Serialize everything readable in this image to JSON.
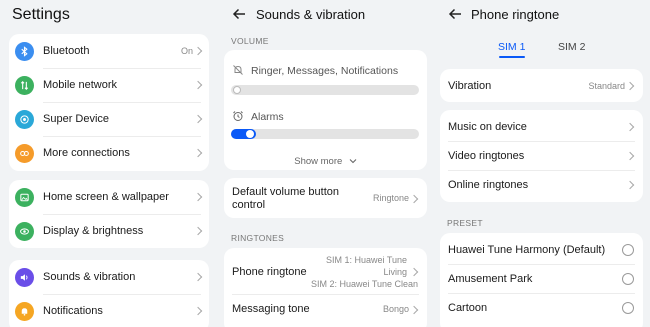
{
  "settings": {
    "title": "Settings",
    "group1": [
      {
        "label": "Bluetooth",
        "value": "On",
        "icon": "bluetooth-icon",
        "color": "#3b8ef0"
      },
      {
        "label": "Mobile network",
        "value": "",
        "icon": "mobile-network-icon",
        "color": "#3cb15f"
      },
      {
        "label": "Super Device",
        "value": "",
        "icon": "super-device-icon",
        "color": "#2aa8d8"
      },
      {
        "label": "More connections",
        "value": "",
        "icon": "more-connections-icon",
        "color": "#f59b2a"
      }
    ],
    "group2": [
      {
        "label": "Home screen & wallpaper",
        "icon": "home-screen-icon",
        "color": "#3cb15f"
      },
      {
        "label": "Display & brightness",
        "icon": "display-icon",
        "color": "#3cb15f"
      }
    ],
    "group3": [
      {
        "label": "Sounds & vibration",
        "icon": "sound-icon",
        "color": "#6a4ee8"
      },
      {
        "label": "Notifications",
        "icon": "notifications-icon",
        "color": "#f5a623"
      }
    ]
  },
  "sounds": {
    "title": "Sounds & vibration",
    "volume_header": "VOLUME",
    "ringer_label": "Ringer, Messages, Notifications",
    "ringer_level": 0,
    "alarms_label": "Alarms",
    "alarms_level": 0.1,
    "show_more": "Show more",
    "default_volume_label": "Default volume button control",
    "default_volume_value": "Ringtone",
    "ringtones_header": "RINGTONES",
    "phone_ringtone_label": "Phone ringtone",
    "phone_ringtone_sim1": "SIM 1: Huawei Tune Living",
    "phone_ringtone_sim2": "SIM 2: Huawei Tune Clean",
    "messaging_tone_label": "Messaging tone",
    "messaging_tone_value": "Bongo"
  },
  "phone_ringtone": {
    "title": "Phone ringtone",
    "tab_sim1": "SIM 1",
    "tab_sim2": "SIM 2",
    "vibration_label": "Vibration",
    "vibration_value": "Standard",
    "sources": [
      "Music on device",
      "Video ringtones",
      "Online ringtones"
    ],
    "preset_header": "PRESET",
    "presets": [
      "Huawei Tune Harmony (Default)",
      "Amusement Park",
      "Cartoon"
    ]
  },
  "accent_color": "#0a59f7"
}
